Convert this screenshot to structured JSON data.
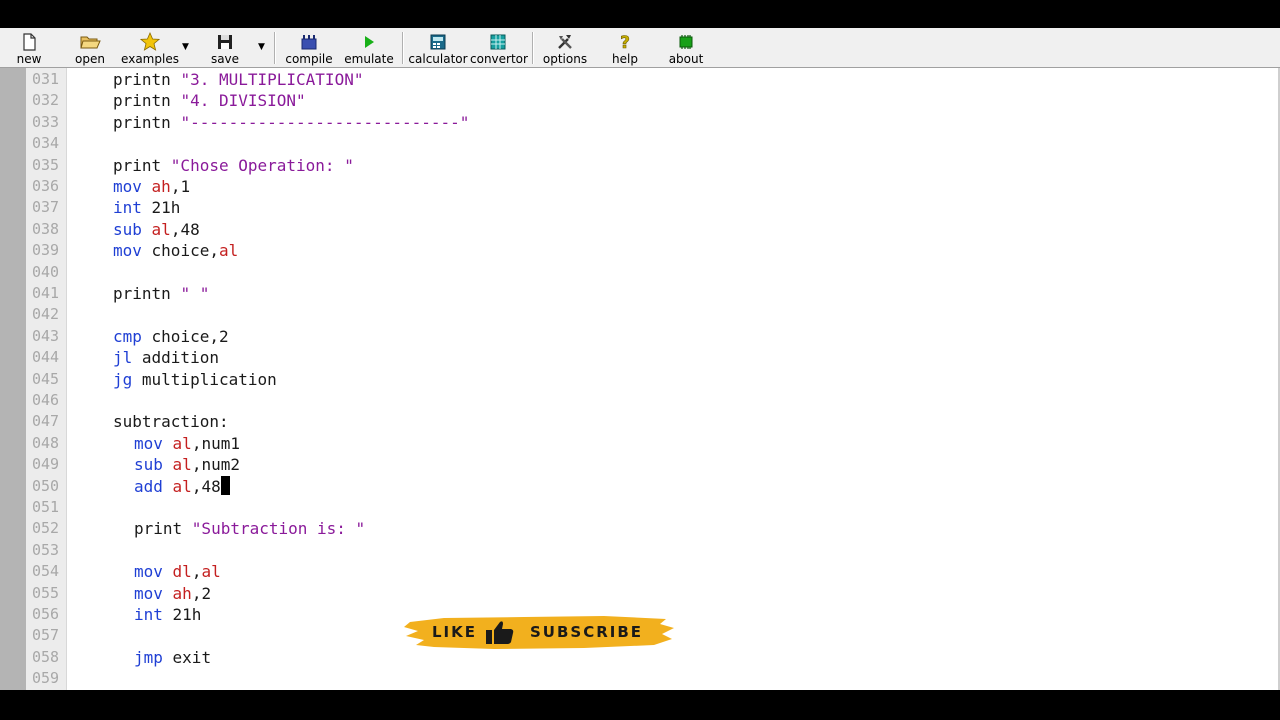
{
  "toolbar": {
    "new": {
      "label": "new",
      "icon": "new-file-icon"
    },
    "open": {
      "label": "open",
      "icon": "open-folder-icon"
    },
    "examples": {
      "label": "examples",
      "icon": "star-icon"
    },
    "save": {
      "label": "save",
      "icon": "floppy-disk-icon"
    },
    "compile": {
      "label": "compile",
      "icon": "compile-icon"
    },
    "emulate": {
      "label": "emulate",
      "icon": "play-icon"
    },
    "calculator": {
      "label": "calculator",
      "icon": "calculator-icon"
    },
    "convertor": {
      "label": "convertor",
      "icon": "convertor-icon"
    },
    "options": {
      "label": "options",
      "icon": "tools-icon"
    },
    "help": {
      "label": "help",
      "icon": "question-icon"
    },
    "about": {
      "label": "about",
      "icon": "chip-icon"
    }
  },
  "colors": {
    "keyword": "#1f3fd4",
    "register": "#c42020",
    "string": "#8a1a9a",
    "line_number": "#a8a8a8",
    "badge": "#f2b01e"
  },
  "lines": [
    {
      "num": "031",
      "indent": 1,
      "tokens": [
        {
          "t": "printn ",
          "c": "plain"
        },
        {
          "t": "\"3. MULTIPLICATION\"",
          "c": "str"
        }
      ]
    },
    {
      "num": "032",
      "indent": 1,
      "tokens": [
        {
          "t": "printn ",
          "c": "plain"
        },
        {
          "t": "\"4. DIVISION\"",
          "c": "str"
        }
      ]
    },
    {
      "num": "033",
      "indent": 1,
      "tokens": [
        {
          "t": "printn ",
          "c": "plain"
        },
        {
          "t": "\"----------------------------\"",
          "c": "str"
        }
      ]
    },
    {
      "num": "034",
      "indent": 1,
      "tokens": []
    },
    {
      "num": "035",
      "indent": 1,
      "tokens": [
        {
          "t": "print ",
          "c": "plain"
        },
        {
          "t": "\"Chose Operation: \"",
          "c": "str"
        }
      ]
    },
    {
      "num": "036",
      "indent": 1,
      "tokens": [
        {
          "t": "mov",
          "c": "kw"
        },
        {
          "t": " ",
          "c": "plain"
        },
        {
          "t": "ah",
          "c": "reg"
        },
        {
          "t": ",1",
          "c": "plain"
        }
      ]
    },
    {
      "num": "037",
      "indent": 1,
      "tokens": [
        {
          "t": "int",
          "c": "kw"
        },
        {
          "t": " 21h",
          "c": "plain"
        }
      ]
    },
    {
      "num": "038",
      "indent": 1,
      "tokens": [
        {
          "t": "sub",
          "c": "kw"
        },
        {
          "t": " ",
          "c": "plain"
        },
        {
          "t": "al",
          "c": "reg"
        },
        {
          "t": ",48",
          "c": "plain"
        }
      ]
    },
    {
      "num": "039",
      "indent": 1,
      "tokens": [
        {
          "t": "mov",
          "c": "kw"
        },
        {
          "t": " choice,",
          "c": "plain"
        },
        {
          "t": "al",
          "c": "reg"
        }
      ]
    },
    {
      "num": "040",
      "indent": 1,
      "tokens": []
    },
    {
      "num": "041",
      "indent": 1,
      "tokens": [
        {
          "t": "printn ",
          "c": "plain"
        },
        {
          "t": "\" \"",
          "c": "str"
        }
      ]
    },
    {
      "num": "042",
      "indent": 1,
      "tokens": []
    },
    {
      "num": "043",
      "indent": 1,
      "tokens": [
        {
          "t": "cmp",
          "c": "kw"
        },
        {
          "t": " choice,2",
          "c": "plain"
        }
      ]
    },
    {
      "num": "044",
      "indent": 1,
      "tokens": [
        {
          "t": "jl",
          "c": "kw"
        },
        {
          "t": " addition",
          "c": "plain"
        }
      ]
    },
    {
      "num": "045",
      "indent": 1,
      "tokens": [
        {
          "t": "jg",
          "c": "kw"
        },
        {
          "t": " multiplication",
          "c": "plain"
        }
      ]
    },
    {
      "num": "046",
      "indent": 1,
      "tokens": []
    },
    {
      "num": "047",
      "indent": 1,
      "tokens": [
        {
          "t": "subtraction:",
          "c": "plain"
        }
      ]
    },
    {
      "num": "048",
      "indent": 2,
      "tokens": [
        {
          "t": "mov",
          "c": "kw"
        },
        {
          "t": " ",
          "c": "plain"
        },
        {
          "t": "al",
          "c": "reg"
        },
        {
          "t": ",num1",
          "c": "plain"
        }
      ]
    },
    {
      "num": "049",
      "indent": 2,
      "tokens": [
        {
          "t": "sub",
          "c": "kw"
        },
        {
          "t": " ",
          "c": "plain"
        },
        {
          "t": "al",
          "c": "reg"
        },
        {
          "t": ",num2",
          "c": "plain"
        }
      ]
    },
    {
      "num": "050",
      "indent": 2,
      "tokens": [
        {
          "t": "add",
          "c": "kw"
        },
        {
          "t": " ",
          "c": "plain"
        },
        {
          "t": "al",
          "c": "reg"
        },
        {
          "t": ",48",
          "c": "plain"
        }
      ],
      "cursor": true
    },
    {
      "num": "051",
      "indent": 2,
      "tokens": []
    },
    {
      "num": "052",
      "indent": 2,
      "tokens": [
        {
          "t": "print ",
          "c": "plain"
        },
        {
          "t": "\"Subtraction is: \"",
          "c": "str"
        }
      ]
    },
    {
      "num": "053",
      "indent": 2,
      "tokens": []
    },
    {
      "num": "054",
      "indent": 2,
      "tokens": [
        {
          "t": "mov",
          "c": "kw"
        },
        {
          "t": " ",
          "c": "plain"
        },
        {
          "t": "dl",
          "c": "reg"
        },
        {
          "t": ",",
          "c": "plain"
        },
        {
          "t": "al",
          "c": "reg"
        }
      ]
    },
    {
      "num": "055",
      "indent": 2,
      "tokens": [
        {
          "t": "mov",
          "c": "kw"
        },
        {
          "t": " ",
          "c": "plain"
        },
        {
          "t": "ah",
          "c": "reg"
        },
        {
          "t": ",2",
          "c": "plain"
        }
      ]
    },
    {
      "num": "056",
      "indent": 2,
      "tokens": [
        {
          "t": "int",
          "c": "kw"
        },
        {
          "t": " 21h",
          "c": "plain"
        }
      ]
    },
    {
      "num": "057",
      "indent": 2,
      "tokens": []
    },
    {
      "num": "058",
      "indent": 2,
      "tokens": [
        {
          "t": "jmp",
          "c": "kw"
        },
        {
          "t": " exit",
          "c": "plain"
        }
      ]
    },
    {
      "num": "059",
      "indent": 2,
      "tokens": []
    }
  ],
  "badge": {
    "like": "LIKE",
    "subscribe": "SUBSCRIBE",
    "icon": "thumbs-up-icon"
  }
}
